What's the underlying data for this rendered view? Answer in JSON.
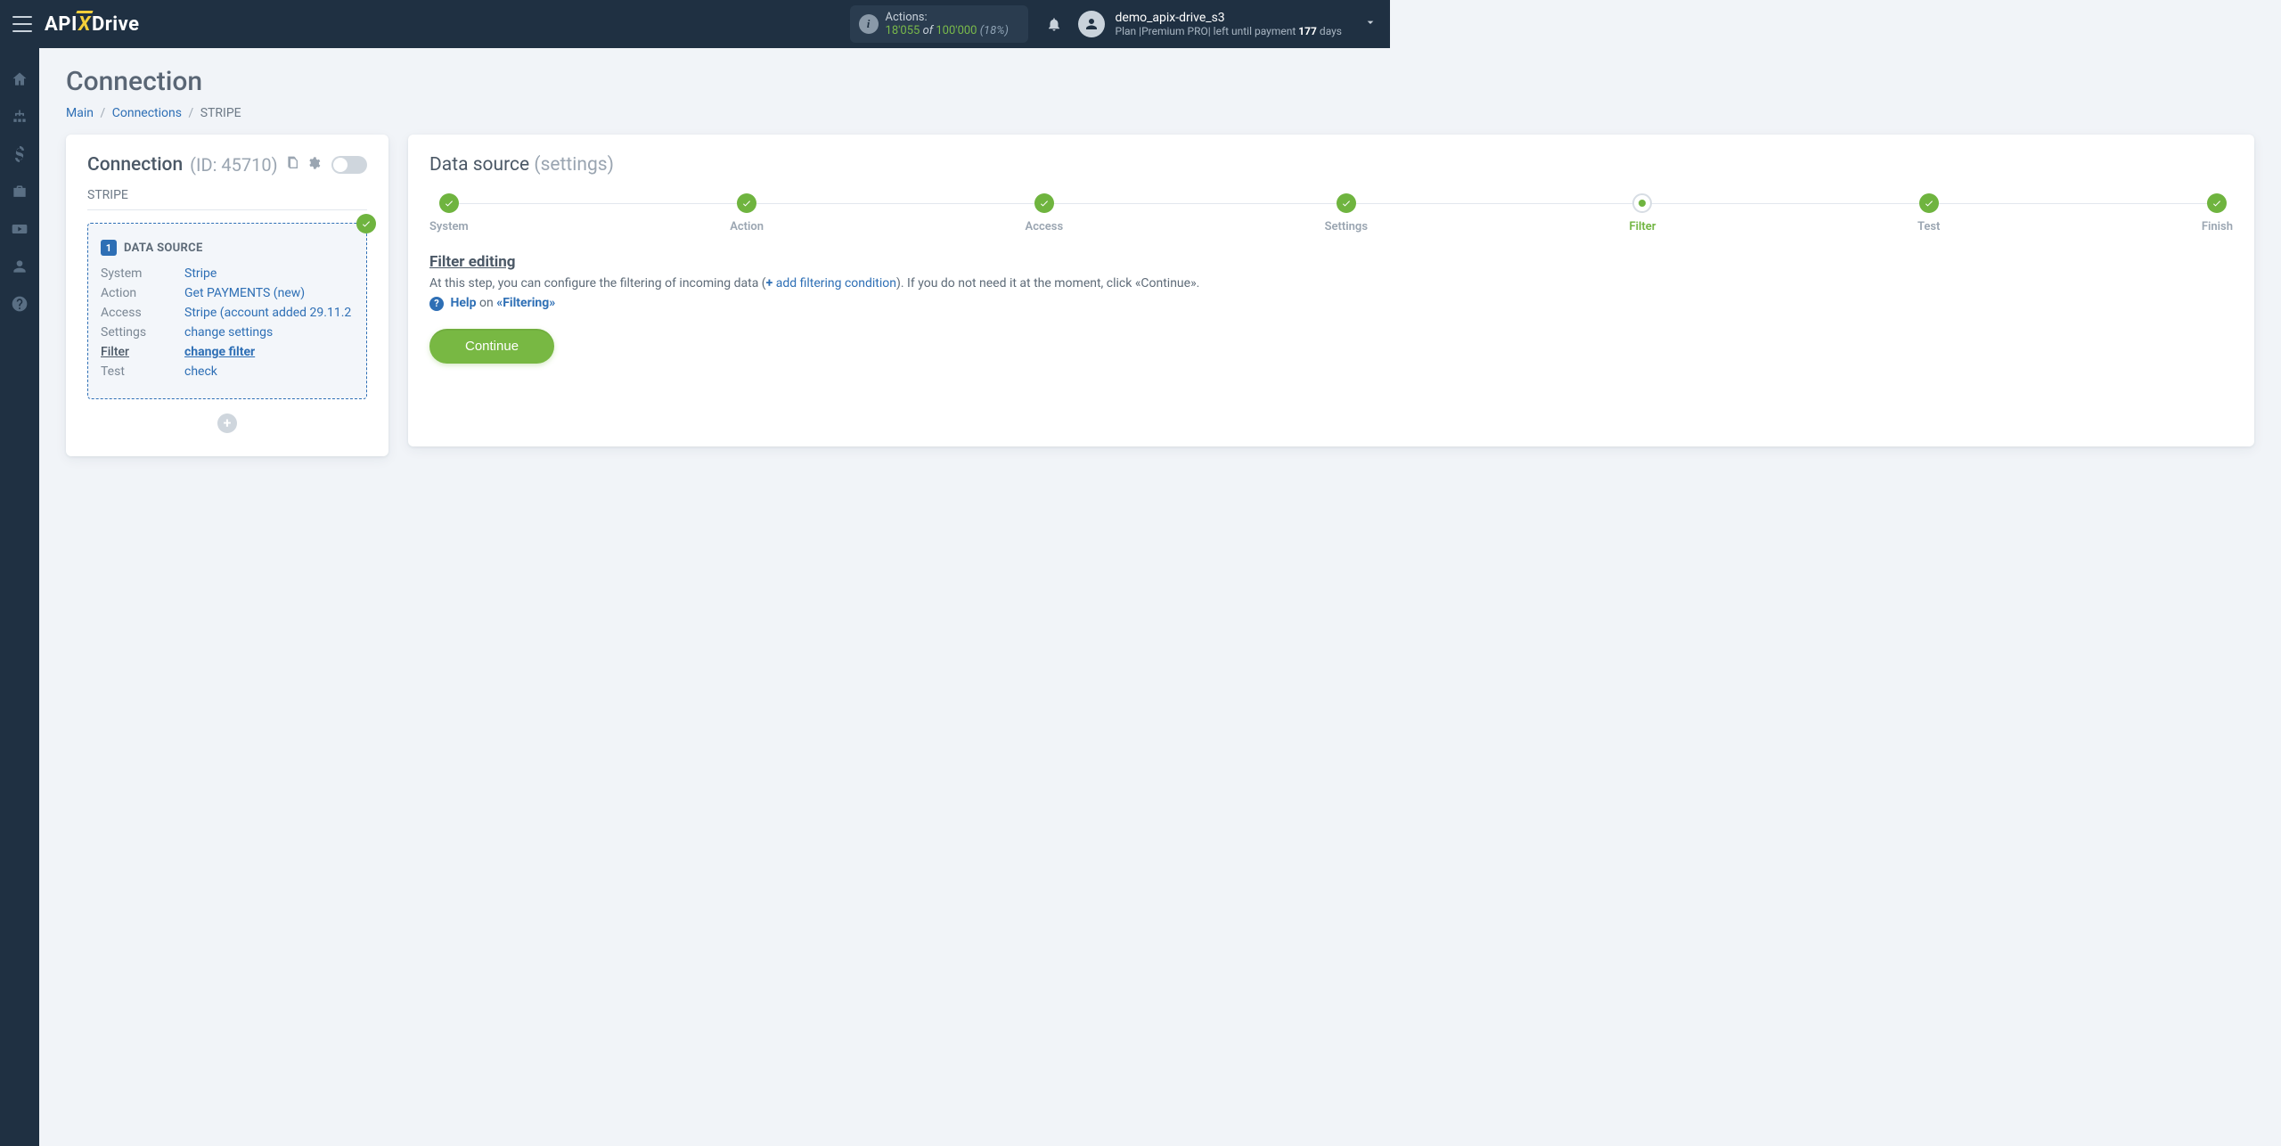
{
  "header": {
    "actions_label": "Actions:",
    "actions_used": "18'055",
    "actions_of": "of",
    "actions_total": "100'000",
    "actions_pct": "(18%)",
    "username": "demo_apix-drive_s3",
    "plan_prefix": "Plan |",
    "plan_name": "Premium PRO",
    "plan_mid": "| left until payment",
    "plan_days": "177",
    "plan_suffix": "days"
  },
  "page": {
    "title": "Connection",
    "breadcrumb": {
      "main": "Main",
      "connections": "Connections",
      "current": "STRIPE"
    }
  },
  "left_card": {
    "title": "Connection",
    "id_label": "(ID: 45710)",
    "system_name": "STRIPE",
    "ds_title": "DATA SOURCE",
    "rows": {
      "system": {
        "label": "System",
        "value": "Stripe"
      },
      "action": {
        "label": "Action",
        "value": "Get PAYMENTS (new)"
      },
      "access": {
        "label": "Access",
        "value": "Stripe (account added 29.11.2"
      },
      "settings": {
        "label": "Settings",
        "value": "change settings"
      },
      "filter": {
        "label": "Filter",
        "value": "change filter"
      },
      "test": {
        "label": "Test",
        "value": "check"
      }
    }
  },
  "right_card": {
    "title": "Data source",
    "subtitle": "(settings)",
    "steps": [
      "System",
      "Action",
      "Access",
      "Settings",
      "Filter",
      "Test",
      "Finish"
    ],
    "current_step_index": 4,
    "section_title": "Filter editing",
    "desc_before": "At this step, you can configure the filtering of incoming data (",
    "desc_plus": "+",
    "desc_link": "add filtering condition",
    "desc_after": "). If you do not need it at the moment, click «Continue».",
    "help_word": "Help",
    "help_on": "on",
    "help_topic": "«Filtering»",
    "continue": "Continue"
  }
}
